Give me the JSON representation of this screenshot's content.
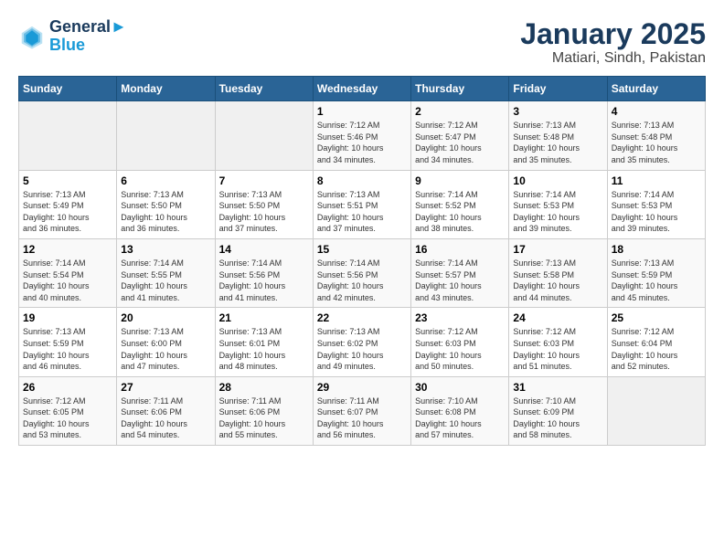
{
  "logo": {
    "line1": "General",
    "line2": "Blue"
  },
  "title": "January 2025",
  "location": "Matiari, Sindh, Pakistan",
  "weekdays": [
    "Sunday",
    "Monday",
    "Tuesday",
    "Wednesday",
    "Thursday",
    "Friday",
    "Saturday"
  ],
  "weeks": [
    [
      {
        "day": "",
        "info": ""
      },
      {
        "day": "",
        "info": ""
      },
      {
        "day": "",
        "info": ""
      },
      {
        "day": "1",
        "info": "Sunrise: 7:12 AM\nSunset: 5:46 PM\nDaylight: 10 hours\nand 34 minutes."
      },
      {
        "day": "2",
        "info": "Sunrise: 7:12 AM\nSunset: 5:47 PM\nDaylight: 10 hours\nand 34 minutes."
      },
      {
        "day": "3",
        "info": "Sunrise: 7:13 AM\nSunset: 5:48 PM\nDaylight: 10 hours\nand 35 minutes."
      },
      {
        "day": "4",
        "info": "Sunrise: 7:13 AM\nSunset: 5:48 PM\nDaylight: 10 hours\nand 35 minutes."
      }
    ],
    [
      {
        "day": "5",
        "info": "Sunrise: 7:13 AM\nSunset: 5:49 PM\nDaylight: 10 hours\nand 36 minutes."
      },
      {
        "day": "6",
        "info": "Sunrise: 7:13 AM\nSunset: 5:50 PM\nDaylight: 10 hours\nand 36 minutes."
      },
      {
        "day": "7",
        "info": "Sunrise: 7:13 AM\nSunset: 5:50 PM\nDaylight: 10 hours\nand 37 minutes."
      },
      {
        "day": "8",
        "info": "Sunrise: 7:13 AM\nSunset: 5:51 PM\nDaylight: 10 hours\nand 37 minutes."
      },
      {
        "day": "9",
        "info": "Sunrise: 7:14 AM\nSunset: 5:52 PM\nDaylight: 10 hours\nand 38 minutes."
      },
      {
        "day": "10",
        "info": "Sunrise: 7:14 AM\nSunset: 5:53 PM\nDaylight: 10 hours\nand 39 minutes."
      },
      {
        "day": "11",
        "info": "Sunrise: 7:14 AM\nSunset: 5:53 PM\nDaylight: 10 hours\nand 39 minutes."
      }
    ],
    [
      {
        "day": "12",
        "info": "Sunrise: 7:14 AM\nSunset: 5:54 PM\nDaylight: 10 hours\nand 40 minutes."
      },
      {
        "day": "13",
        "info": "Sunrise: 7:14 AM\nSunset: 5:55 PM\nDaylight: 10 hours\nand 41 minutes."
      },
      {
        "day": "14",
        "info": "Sunrise: 7:14 AM\nSunset: 5:56 PM\nDaylight: 10 hours\nand 41 minutes."
      },
      {
        "day": "15",
        "info": "Sunrise: 7:14 AM\nSunset: 5:56 PM\nDaylight: 10 hours\nand 42 minutes."
      },
      {
        "day": "16",
        "info": "Sunrise: 7:14 AM\nSunset: 5:57 PM\nDaylight: 10 hours\nand 43 minutes."
      },
      {
        "day": "17",
        "info": "Sunrise: 7:13 AM\nSunset: 5:58 PM\nDaylight: 10 hours\nand 44 minutes."
      },
      {
        "day": "18",
        "info": "Sunrise: 7:13 AM\nSunset: 5:59 PM\nDaylight: 10 hours\nand 45 minutes."
      }
    ],
    [
      {
        "day": "19",
        "info": "Sunrise: 7:13 AM\nSunset: 5:59 PM\nDaylight: 10 hours\nand 46 minutes."
      },
      {
        "day": "20",
        "info": "Sunrise: 7:13 AM\nSunset: 6:00 PM\nDaylight: 10 hours\nand 47 minutes."
      },
      {
        "day": "21",
        "info": "Sunrise: 7:13 AM\nSunset: 6:01 PM\nDaylight: 10 hours\nand 48 minutes."
      },
      {
        "day": "22",
        "info": "Sunrise: 7:13 AM\nSunset: 6:02 PM\nDaylight: 10 hours\nand 49 minutes."
      },
      {
        "day": "23",
        "info": "Sunrise: 7:12 AM\nSunset: 6:03 PM\nDaylight: 10 hours\nand 50 minutes."
      },
      {
        "day": "24",
        "info": "Sunrise: 7:12 AM\nSunset: 6:03 PM\nDaylight: 10 hours\nand 51 minutes."
      },
      {
        "day": "25",
        "info": "Sunrise: 7:12 AM\nSunset: 6:04 PM\nDaylight: 10 hours\nand 52 minutes."
      }
    ],
    [
      {
        "day": "26",
        "info": "Sunrise: 7:12 AM\nSunset: 6:05 PM\nDaylight: 10 hours\nand 53 minutes."
      },
      {
        "day": "27",
        "info": "Sunrise: 7:11 AM\nSunset: 6:06 PM\nDaylight: 10 hours\nand 54 minutes."
      },
      {
        "day": "28",
        "info": "Sunrise: 7:11 AM\nSunset: 6:06 PM\nDaylight: 10 hours\nand 55 minutes."
      },
      {
        "day": "29",
        "info": "Sunrise: 7:11 AM\nSunset: 6:07 PM\nDaylight: 10 hours\nand 56 minutes."
      },
      {
        "day": "30",
        "info": "Sunrise: 7:10 AM\nSunset: 6:08 PM\nDaylight: 10 hours\nand 57 minutes."
      },
      {
        "day": "31",
        "info": "Sunrise: 7:10 AM\nSunset: 6:09 PM\nDaylight: 10 hours\nand 58 minutes."
      },
      {
        "day": "",
        "info": ""
      }
    ]
  ]
}
